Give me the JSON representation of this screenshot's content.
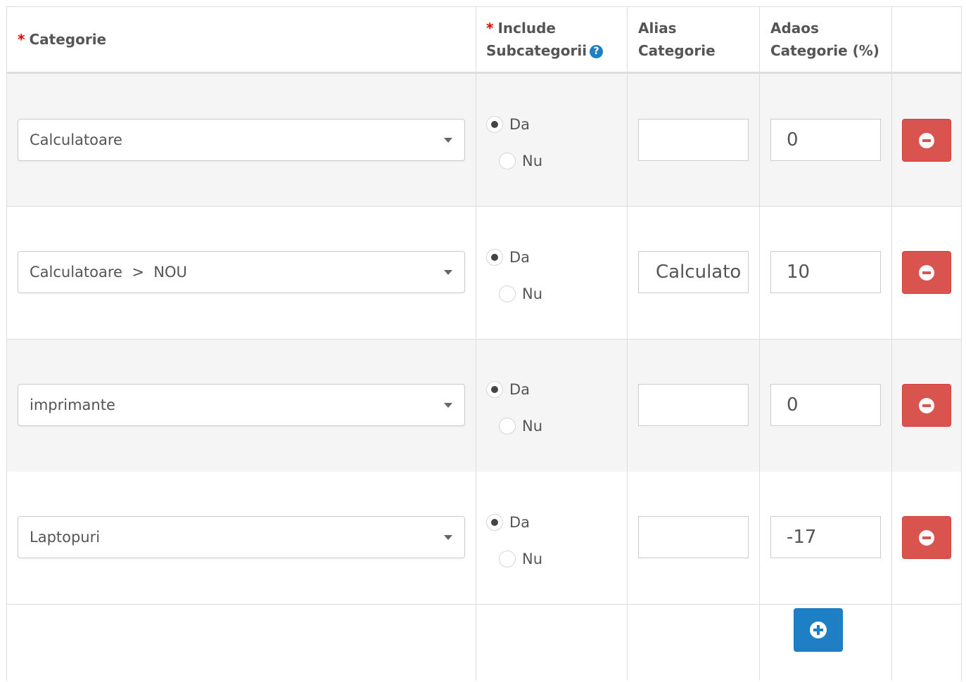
{
  "header": {
    "category": "Categorie",
    "include_line1": "Include",
    "include_line2": "Subcategorii",
    "alias_line1": "Alias",
    "alias_line2": "Categorie",
    "markup_line1": "Adaos",
    "markup_line2": "Categorie (%)",
    "required_mark": "*",
    "help_glyph": "?"
  },
  "radio_labels": {
    "yes": "Da",
    "no": "Nu"
  },
  "rows": [
    {
      "category": "Calculatoare",
      "include_subcategories": "Da",
      "alias": "",
      "markup": "0"
    },
    {
      "category": "Calculatoare  >  NOU",
      "include_subcategories": "Da",
      "alias": "Calculato",
      "markup": "10"
    },
    {
      "category": "imprimante",
      "include_subcategories": "Da",
      "alias": "",
      "markup": "0"
    },
    {
      "category": "Laptopuri",
      "include_subcategories": "Da",
      "alias": "",
      "markup": "-17"
    }
  ],
  "icons": {
    "remove": "minus-circle-icon",
    "add": "plus-circle-icon",
    "help": "question-circle-icon",
    "dropdown": "caret-down-icon"
  },
  "colors": {
    "danger": "#d9534f",
    "primary": "#1e7fc4",
    "required": "#e00000",
    "striped_row": "#f5f5f5"
  }
}
